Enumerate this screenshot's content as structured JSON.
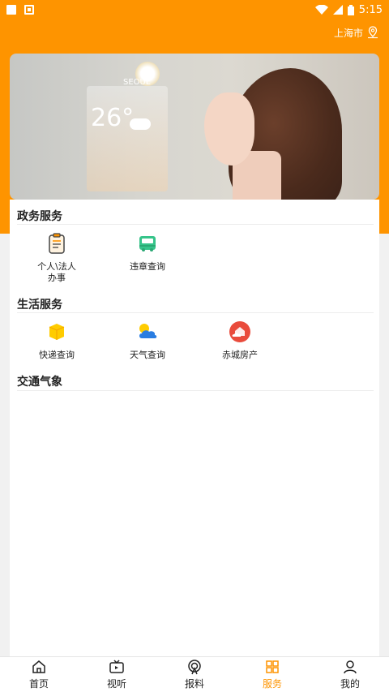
{
  "status_bar": {
    "time": "5:15",
    "icons": [
      "notification-square-icon",
      "notification-photo-icon",
      "wifi-icon",
      "signal-icon",
      "battery-icon"
    ]
  },
  "header": {
    "city": "上海市",
    "city_icon": "location-pin-icon"
  },
  "banner": {
    "city_label": "SEOUL",
    "temperature": "26°"
  },
  "sections": [
    {
      "title": "政务服务",
      "items": [
        {
          "label": "个人\\法人\n办事",
          "icon": "clipboard-icon",
          "color": "#fe9400"
        },
        {
          "label": "违章查询",
          "icon": "bus-icon",
          "color": "#36c48a"
        }
      ]
    },
    {
      "title": "生活服务",
      "items": [
        {
          "label": "快递查询",
          "icon": "package-icon",
          "color": "#ffcc00"
        },
        {
          "label": "天气查询",
          "icon": "weather-icon",
          "color": "#2a7de1"
        },
        {
          "label": "赤城房产",
          "icon": "house-cloud-icon",
          "color": "#e94b3c"
        }
      ]
    },
    {
      "title": "交通气象",
      "items": []
    }
  ],
  "tabs": [
    {
      "label": "首页",
      "icon": "home-icon"
    },
    {
      "label": "视听",
      "icon": "tv-icon"
    },
    {
      "label": "报料",
      "icon": "broadcast-icon"
    },
    {
      "label": "服务",
      "icon": "grid-icon",
      "active": true
    },
    {
      "label": "我的",
      "icon": "person-icon"
    }
  ],
  "colors": {
    "brand": "#fe9400",
    "active_tab": "#fe9400"
  }
}
